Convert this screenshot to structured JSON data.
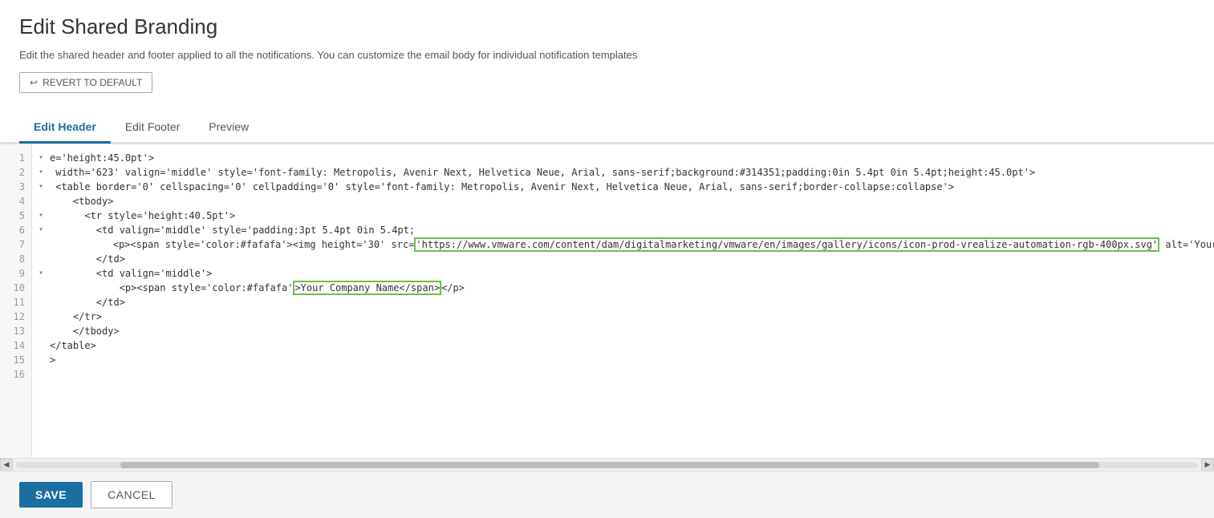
{
  "page": {
    "title": "Edit Shared Branding",
    "description": "Edit the shared header and footer applied to all the notifications. You can customize the email body for individual notification templates"
  },
  "revert_button": {
    "label": "REVERT TO DEFAULT"
  },
  "tabs": [
    {
      "id": "edit-header",
      "label": "Edit Header",
      "active": true
    },
    {
      "id": "edit-footer",
      "label": "Edit Footer",
      "active": false
    },
    {
      "id": "preview",
      "label": "Preview",
      "active": false
    }
  ],
  "editor": {
    "lines": [
      {
        "num": 1,
        "fold": true,
        "content": "e='height:45.0pt'>"
      },
      {
        "num": 2,
        "fold": true,
        "content": " width='623' valign='middle' style='font-family: Metropolis, Avenir Next, Helvetica Neue, Arial, sans-serif;background:#314351;padding:0in 5.4pt 0in 5.4pt;height:45.0pt'>"
      },
      {
        "num": 3,
        "fold": true,
        "content": " <table border='0' cellspacing='0' cellpadding='0' style='font-family: Metropolis, Avenir Next, Helvetica Neue, Arial, sans-serif;border-collapse:collapse'>"
      },
      {
        "num": 4,
        "fold": false,
        "content": "    <tbody>"
      },
      {
        "num": 5,
        "fold": true,
        "content": "      <tr style='height:40.5pt'>"
      },
      {
        "num": 6,
        "fold": true,
        "content": "        <td valign='middle' style='padding:3pt 5.4pt 0in 5.4pt;"
      },
      {
        "num": 7,
        "fold": false,
        "content": "            <p><span style='color:#fafafa'><img height='30' src=",
        "url": "https://www.vmware.com/content/dam/digitalmarketing/vmware/en/images/gallery/icons/icon-prod-vrealize-automation-rgb-400px.svg",
        "after": " alt='Your Company Name' cl"
      },
      {
        "num": 8,
        "fold": false,
        "content": "        </td>"
      },
      {
        "num": 9,
        "fold": true,
        "content": "        <td valign='middle'>"
      },
      {
        "num": 10,
        "fold": false,
        "content": "            <p><span style='color:#fafafa",
        "company": ">Your Company Name</span></p>"
      },
      {
        "num": 11,
        "fold": false,
        "content": "        </td>"
      },
      {
        "num": 12,
        "fold": false,
        "content": "    </tr>"
      },
      {
        "num": 13,
        "fold": false,
        "content": "    </tbody>"
      },
      {
        "num": 14,
        "fold": false,
        "content": "</table>"
      },
      {
        "num": 15,
        "fold": false,
        "content": ">"
      },
      {
        "num": 16,
        "fold": false,
        "content": ""
      }
    ]
  },
  "footer": {
    "save_label": "SAVE",
    "cancel_label": "CANCEL"
  }
}
